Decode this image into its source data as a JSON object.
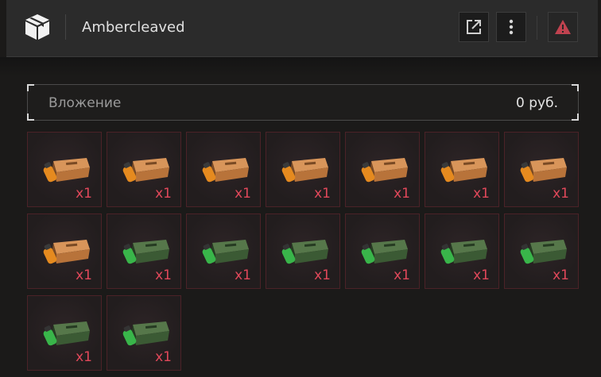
{
  "header": {
    "title": "Ambercleaved",
    "icons": {
      "logo": "cube-box-icon",
      "open": "external-link-icon",
      "menu": "more-vertical-icon",
      "warn": "warning-triangle-icon"
    }
  },
  "investment": {
    "label": "Вложение",
    "value": "0 руб."
  },
  "colors": {
    "accent_red": "#e0485a",
    "orange_case": "#c97b3a",
    "green_case": "#3f6a36"
  },
  "items": [
    {
      "variant": "orange",
      "qty": "x1"
    },
    {
      "variant": "orange",
      "qty": "x1"
    },
    {
      "variant": "orange",
      "qty": "x1"
    },
    {
      "variant": "orange",
      "qty": "x1"
    },
    {
      "variant": "orange",
      "qty": "x1"
    },
    {
      "variant": "orange",
      "qty": "x1"
    },
    {
      "variant": "orange",
      "qty": "x1"
    },
    {
      "variant": "orange",
      "qty": "x1"
    },
    {
      "variant": "green",
      "qty": "x1"
    },
    {
      "variant": "green",
      "qty": "x1"
    },
    {
      "variant": "green",
      "qty": "x1"
    },
    {
      "variant": "green",
      "qty": "x1"
    },
    {
      "variant": "green",
      "qty": "x1"
    },
    {
      "variant": "green",
      "qty": "x1"
    },
    {
      "variant": "green",
      "qty": "x1"
    },
    {
      "variant": "green",
      "qty": "x1"
    }
  ]
}
